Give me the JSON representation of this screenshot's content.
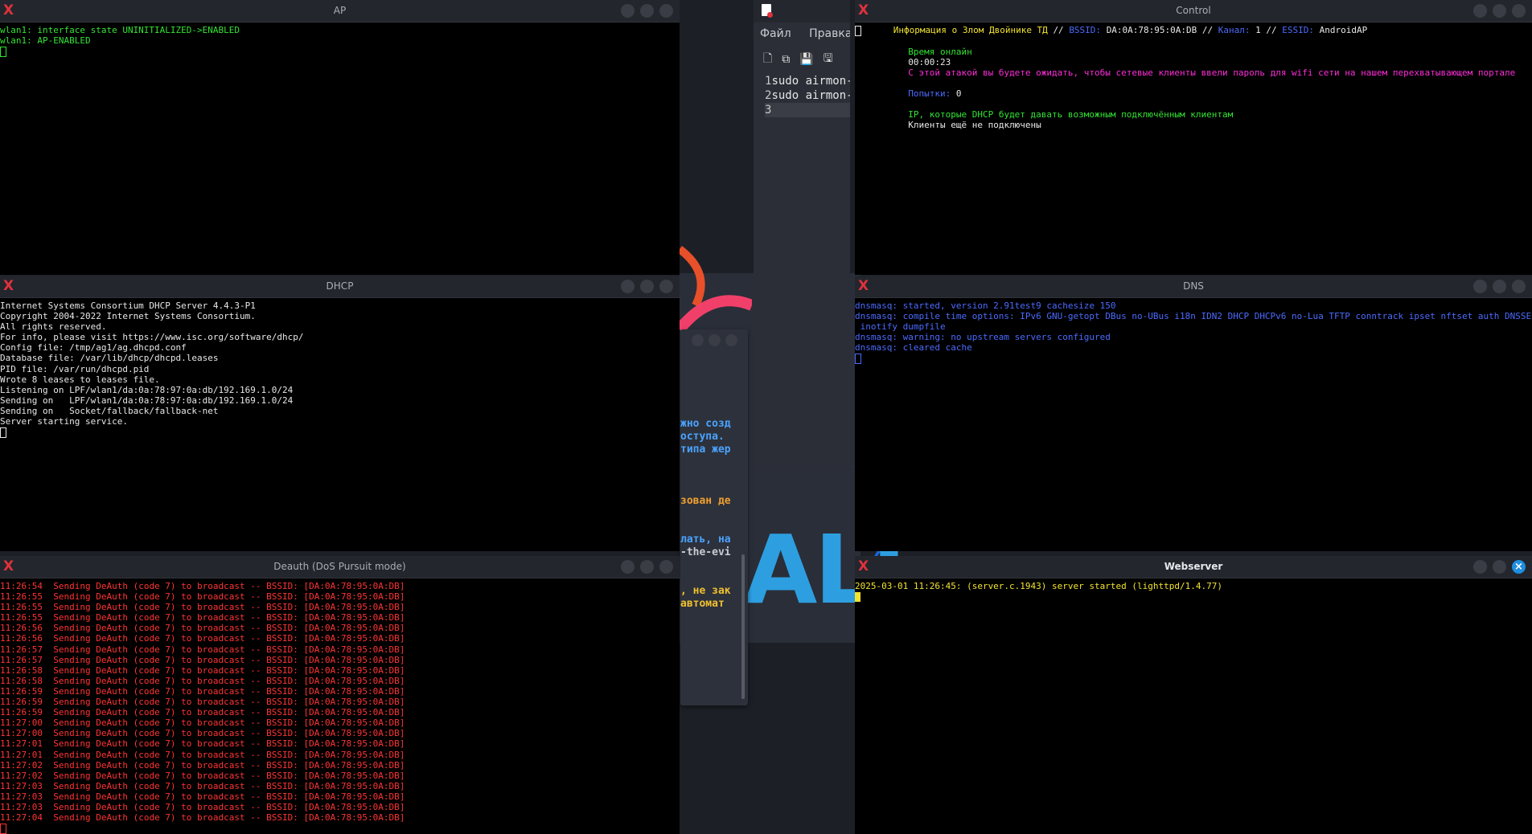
{
  "windows": {
    "ap": {
      "title": "AP",
      "lines": [
        "wlan1: interface state UNINITIALIZED->ENABLED",
        "wlan1: AP-ENABLED"
      ]
    },
    "dhcp": {
      "title": "DHCP",
      "lines": [
        "Internet Systems Consortium DHCP Server 4.4.3-P1",
        "Copyright 2004-2022 Internet Systems Consortium.",
        "All rights reserved.",
        "For info, please visit https://www.isc.org/software/dhcp/",
        "Config file: /tmp/ag1/ag.dhcpd.conf",
        "Database file: /var/lib/dhcp/dhcpd.leases",
        "PID file: /var/run/dhcpd.pid",
        "Wrote 8 leases to leases file.",
        "Listening on LPF/wlan1/da:0a:78:97:0a:db/192.169.1.0/24",
        "Sending on   LPF/wlan1/da:0a:78:97:0a:db/192.169.1.0/24",
        "Sending on   Socket/fallback/fallback-net",
        "Server starting service."
      ]
    },
    "deauth": {
      "title": "Deauth (DoS Pursuit mode)",
      "message": "Sending DeAuth (code 7) to broadcast -- BSSID: [DA:0A:78:95:0A:DB]",
      "times": [
        "11:26:54",
        "11:26:55",
        "11:26:55",
        "11:26:55",
        "11:26:56",
        "11:26:56",
        "11:26:57",
        "11:26:57",
        "11:26:58",
        "11:26:58",
        "11:26:59",
        "11:26:59",
        "11:26:59",
        "11:27:00",
        "11:27:00",
        "11:27:01",
        "11:27:01",
        "11:27:02",
        "11:27:02",
        "11:27:03",
        "11:27:03",
        "11:27:03",
        "11:27:04"
      ]
    },
    "control": {
      "title": "Control",
      "info_label": "Информация о Злом Двойнике ТД",
      "sep": "//",
      "bssid_label": "BSSID:",
      "bssid": "DA:0A:78:95:0A:DB",
      "channel_label": "Канал:",
      "channel": "1",
      "essid_label": "ESSID:",
      "essid": "AndroidAP",
      "uptime_label": "Время онлайн",
      "uptime": "00:00:23",
      "attack_msg": "С этой атакой вы будете ожидать, чтобы сетевые клиенты ввели пароль для wifi сети на нашем перехватывающем портале",
      "attempts_label": "Попытки:",
      "attempts": "0",
      "ip_msg": "IP, которые DHCP будет давать возможным подключённым клиентам",
      "clients_msg": "Клиенты ещё не подключены"
    },
    "dns": {
      "title": "DNS",
      "lines": [
        "dnsmasq: started, version 2.91test9 cachesize 150",
        "dnsmasq: compile time options: IPv6 GNU-getopt DBus no-UBus i18n IDN2 DHCP DHCPv6 no-Lua TFTP conntrack ipset nftset auth DNSSEC loop-detect",
        " inotify dumpfile",
        "dnsmasq: warning: no upstream servers configured",
        "dnsmasq: cleared cache"
      ]
    },
    "webserver": {
      "title": "Webserver",
      "lines": [
        "2025-03-01 11:26:45: (server.c.1943) server started (lighttpd/1.4.77)"
      ]
    }
  },
  "editor": {
    "menu_file": "Файл",
    "menu_edit": "Правка",
    "lines": [
      "sudo airmon-",
      "sudo airmon-",
      ""
    ]
  },
  "background_doc": {
    "lines": [
      "жно созд",
      "оступа.",
      "типа жер",
      "зован де",
      "лать, на",
      "-the-evi",
      ", не зак",
      " автомат"
    ]
  },
  "desktop": {
    "logo_text": "ALI"
  }
}
